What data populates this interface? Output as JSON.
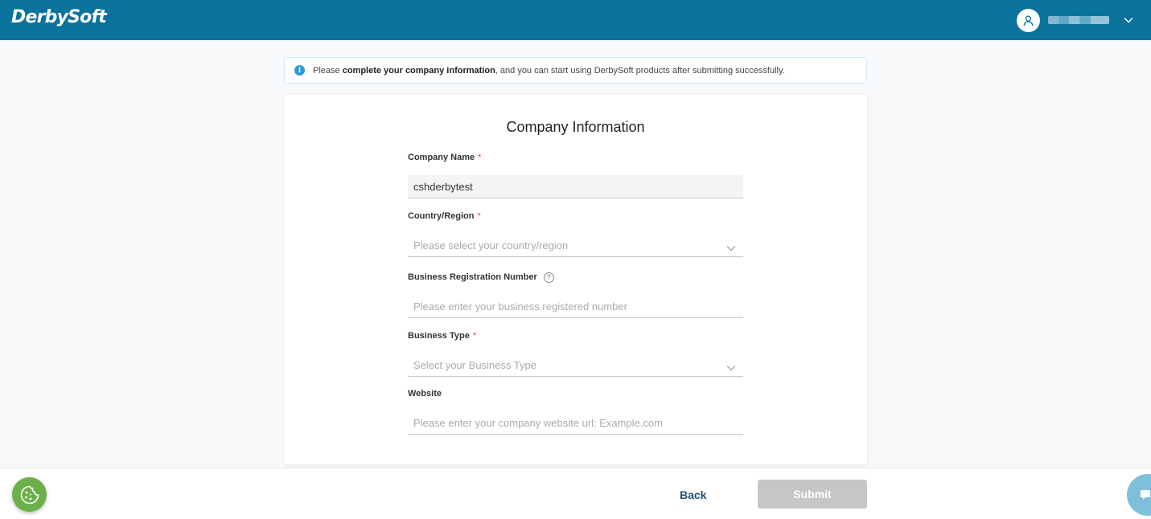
{
  "header": {
    "logo": "DerbySoft",
    "user_icon": "user-icon",
    "user_chevron_icon": "chevron-down-icon"
  },
  "notice": {
    "icon": "info-icon",
    "prefix": "Please ",
    "bold": "complete your company information",
    "suffix": ", and you can start using DerbySoft products after submitting successfully."
  },
  "form": {
    "title": "Company Information",
    "company_name": {
      "label": "Company Name",
      "required": "*",
      "value": "cshderbytest"
    },
    "country": {
      "label": "Country/Region",
      "required": "*",
      "placeholder": "Please select your country/region"
    },
    "brn": {
      "label": "Business Registration Number",
      "help_icon": "?",
      "placeholder": "Please enter your business registered number"
    },
    "business_type": {
      "label": "Business Type",
      "required": "*",
      "placeholder": "Select your Business Type"
    },
    "website": {
      "label": "Website",
      "placeholder": "Please enter your company website url: Example.com"
    }
  },
  "footer": {
    "back_label": "Back",
    "submit_label": "Submit"
  },
  "colors": {
    "header_bg": "#09739c",
    "required": "#e0463a",
    "submit_disabled": "#c6c6c6",
    "cookie_btn": "#6bb04a"
  }
}
